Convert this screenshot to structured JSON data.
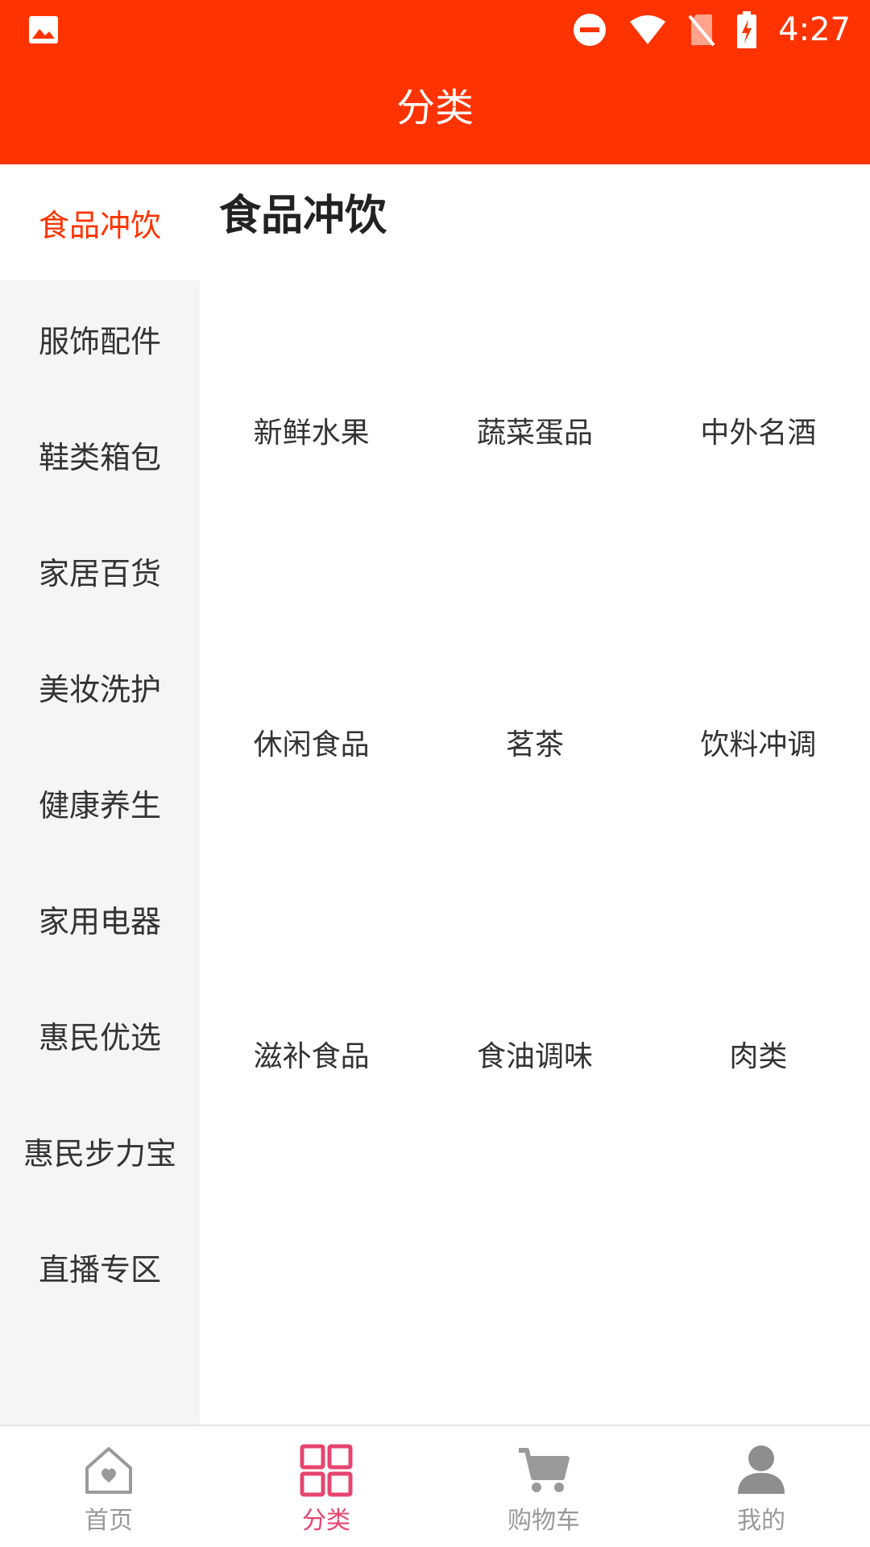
{
  "status_bar": {
    "time": "4:27",
    "icons": [
      "image-icon",
      "dnd-icon",
      "wifi-icon",
      "no-sim-icon",
      "battery-charging-icon"
    ]
  },
  "header": {
    "title": "分类",
    "background_color": "#ff3300"
  },
  "sidebar": {
    "items": [
      {
        "label": "食品冲饮",
        "active": true
      },
      {
        "label": "服饰配件",
        "active": false
      },
      {
        "label": "鞋类箱包",
        "active": false
      },
      {
        "label": "家居百货",
        "active": false
      },
      {
        "label": "美妆洗护",
        "active": false
      },
      {
        "label": "健康养生",
        "active": false
      },
      {
        "label": "家用电器",
        "active": false
      },
      {
        "label": "惠民优选",
        "active": false
      },
      {
        "label": "惠民步力宝",
        "active": false
      },
      {
        "label": "直播专区",
        "active": false
      }
    ]
  },
  "main": {
    "section_title": "食品冲饮",
    "subcategories": [
      "新鲜水果",
      "蔬菜蛋品",
      "中外名酒",
      "休闲食品",
      "茗茶",
      "饮料冲调",
      "滋补食品",
      "食油调味",
      "肉类"
    ]
  },
  "bottom_nav": {
    "items": [
      {
        "label": "首页",
        "icon": "home-icon",
        "active": false
      },
      {
        "label": "分类",
        "icon": "category-grid-icon",
        "active": true
      },
      {
        "label": "购物车",
        "icon": "cart-icon",
        "active": false
      },
      {
        "label": "我的",
        "icon": "profile-icon",
        "active": false
      }
    ],
    "active_color": "#e6456f",
    "inactive_color": "#999999"
  }
}
